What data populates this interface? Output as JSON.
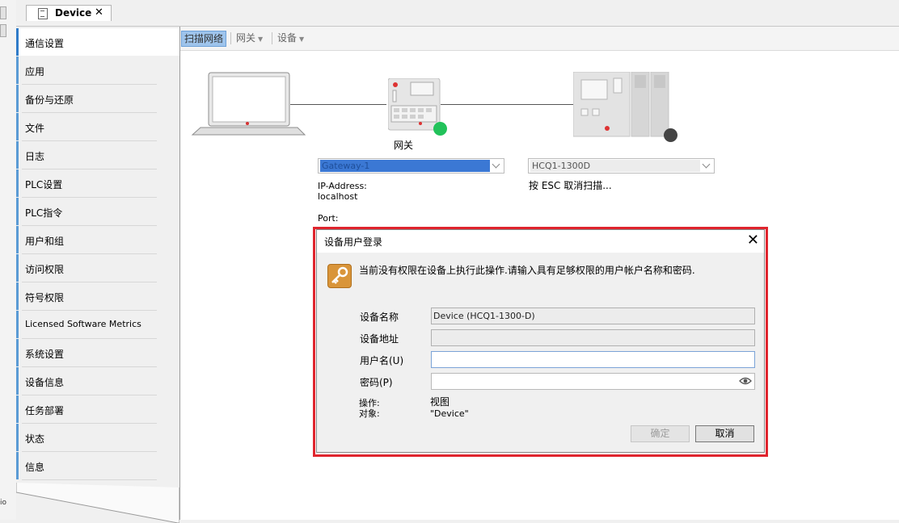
{
  "tab": {
    "title": "Device"
  },
  "left_strip": {
    "fragment": "io"
  },
  "sidebar": {
    "items": [
      {
        "label": "通信设置"
      },
      {
        "label": "应用"
      },
      {
        "label": "备份与还原"
      },
      {
        "label": "文件"
      },
      {
        "label": "日志"
      },
      {
        "label": "PLC设置"
      },
      {
        "label": "PLC指令"
      },
      {
        "label": "用户和组"
      },
      {
        "label": "访问权限"
      },
      {
        "label": "符号权限"
      },
      {
        "label": "Licensed Software Metrics"
      },
      {
        "label": "系统设置"
      },
      {
        "label": "设备信息"
      },
      {
        "label": "任务部署"
      },
      {
        "label": "状态"
      },
      {
        "label": "信息"
      }
    ]
  },
  "toolbar": {
    "scan_network": "扫描网络",
    "gateway": "网关",
    "device": "设备"
  },
  "gateway": {
    "label": "网关",
    "selected": "Gateway-1",
    "ip_label": "IP-Address:",
    "ip_value": "localhost",
    "port_label": "Port:",
    "status_color": "#22c25a"
  },
  "target": {
    "selected": "HCQ1-1300D",
    "scan_hint": "按 ESC 取消扫描...",
    "status_color": "#444444"
  },
  "dialog": {
    "title": "设备用户登录",
    "message": "当前没有权限在设备上执行此操作.请输入具有足够权限的用户帐户名称和密码.",
    "device_name_label": "设备名称",
    "device_name_value": "Device (HCQ1-1300-D)",
    "device_address_label": "设备地址",
    "device_address_value": "",
    "username_label": "用户名(U)",
    "username_value": "",
    "password_label": "密码(P)",
    "password_value": "",
    "operation_label": "操作:",
    "operation_value": "视图",
    "object_label": "对象:",
    "object_value": "\"Device\"",
    "ok_label": "确定",
    "cancel_label": "取消"
  },
  "colors": {
    "accent": "#5a9bd5",
    "highlight_frame": "#e0252e"
  }
}
